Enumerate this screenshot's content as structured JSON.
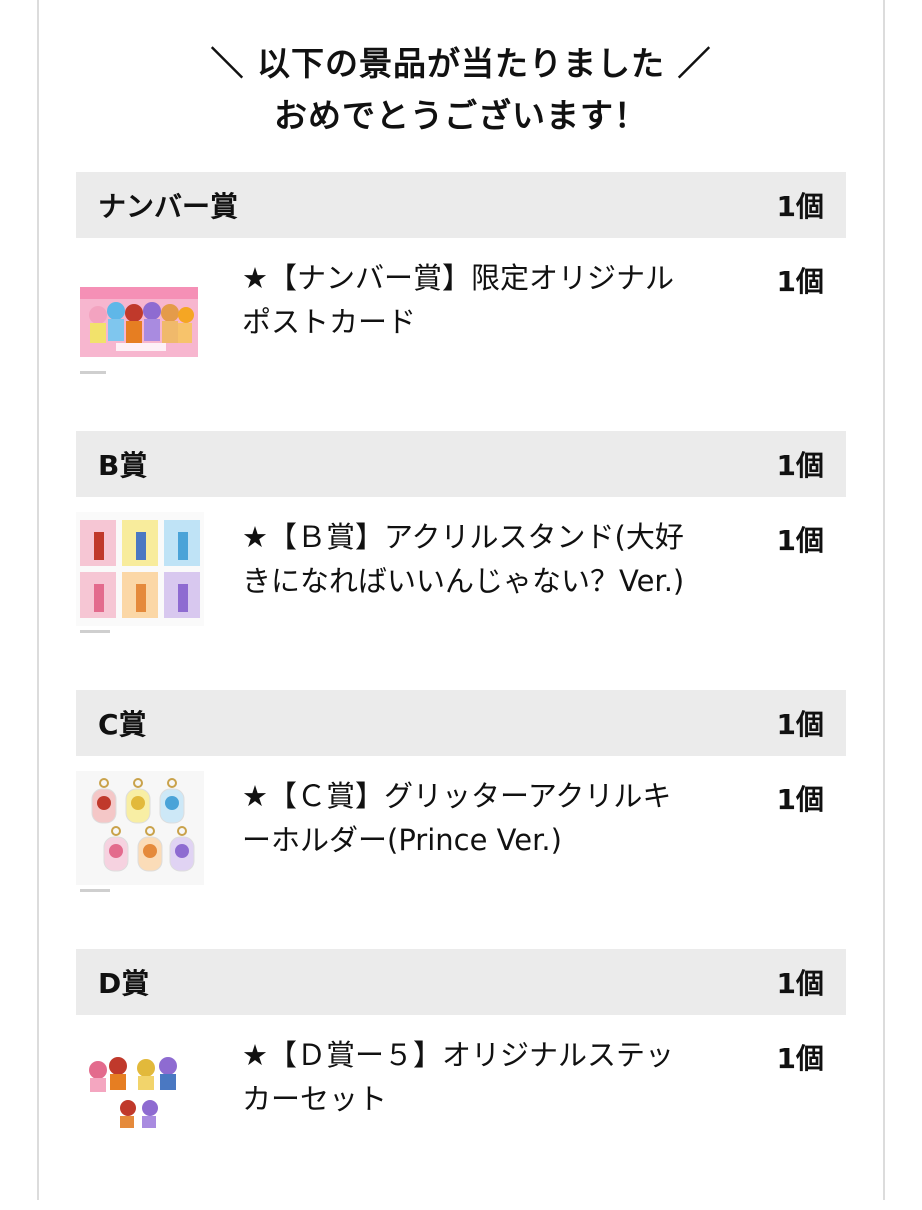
{
  "heading": {
    "line1": "＼ 以下の景品が当たりました ／",
    "line2": "おめでとうございます！"
  },
  "prizes": [
    {
      "category": "ナンバー賞",
      "category_count": "1個",
      "item_title_line1": "★【ナンバー賞】限定オリジナル",
      "item_title_line2": "ポストカード",
      "item_count": "1個",
      "thumb_icon": "postcard-image"
    },
    {
      "category": "B賞",
      "category_count": "1個",
      "item_title_line1": "★【Ｂ賞】アクリルスタンド(大好",
      "item_title_line2": "きになればいいんじゃない？Ver.)",
      "item_count": "1個",
      "thumb_icon": "acrylic-stand-image"
    },
    {
      "category": "C賞",
      "category_count": "1個",
      "item_title_line1": "★【Ｃ賞】グリッターアクリルキ",
      "item_title_line2": "ーホルダー(Prince Ver.)",
      "item_count": "1個",
      "thumb_icon": "keyholder-image"
    },
    {
      "category": "D賞",
      "category_count": "1個",
      "item_title_line1": "★【Ｄ賞ー５】オリジナルステッ",
      "item_title_line2": "カーセット",
      "item_count": "1個",
      "thumb_icon": "sticker-set-image"
    }
  ]
}
